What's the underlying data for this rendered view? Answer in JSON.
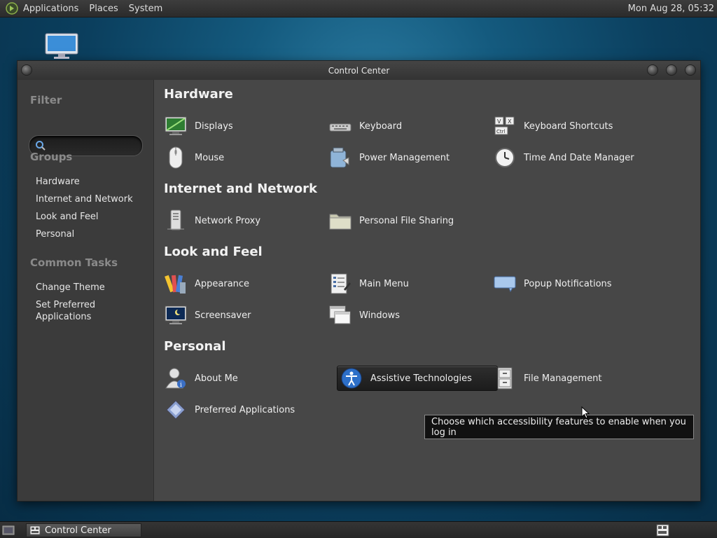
{
  "top_panel": {
    "menus": [
      "Applications",
      "Places",
      "System"
    ],
    "clock": "Mon Aug 28, 05:32"
  },
  "window": {
    "title": "Control Center",
    "sidebar": {
      "filter_heading": "Filter",
      "search_placeholder": "",
      "groups_heading": "Groups",
      "groups": [
        "Hardware",
        "Internet and Network",
        "Look and Feel",
        "Personal"
      ],
      "tasks_heading": "Common Tasks",
      "tasks": [
        "Change Theme",
        "Set Preferred Applications"
      ]
    },
    "groups": [
      {
        "title": "Hardware",
        "items": [
          "Displays",
          "Keyboard",
          "Keyboard Shortcuts",
          "Mouse",
          "Power Management",
          "Time And Date Manager"
        ]
      },
      {
        "title": "Internet and Network",
        "items": [
          "Network Proxy",
          "Personal File Sharing"
        ]
      },
      {
        "title": "Look and Feel",
        "items": [
          "Appearance",
          "Main Menu",
          "Popup Notifications",
          "Screensaver",
          "Windows"
        ]
      },
      {
        "title": "Personal",
        "items": [
          "About Me",
          "Assistive Technologies",
          "File Management",
          "Preferred Applications"
        ]
      }
    ],
    "tooltip": "Choose which accessibility features to enable when you log in"
  },
  "taskbar": {
    "task_label": "Control Center"
  }
}
